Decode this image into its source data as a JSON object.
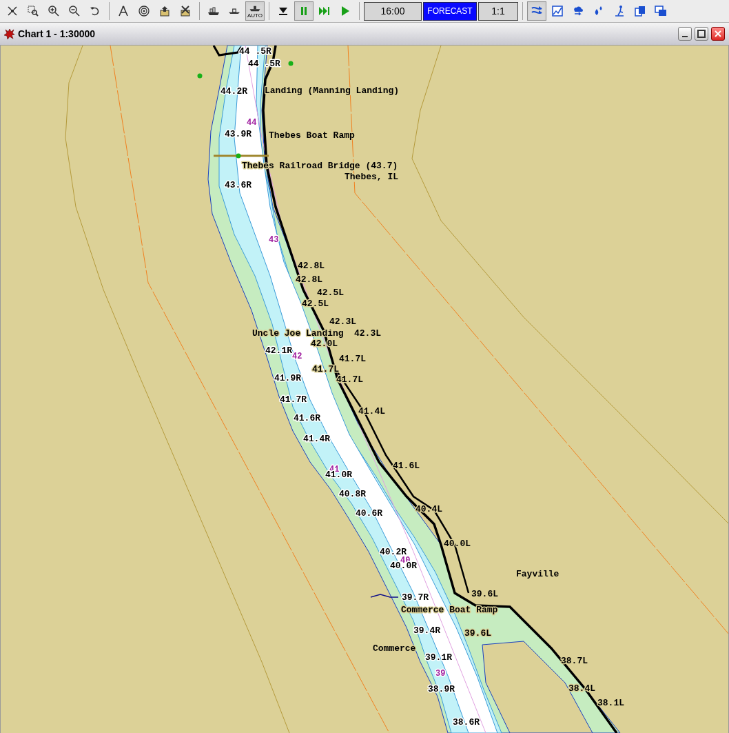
{
  "toolbar": {
    "buttons": [
      {
        "kind": "fit",
        "pressed": false
      },
      {
        "kind": "zoom-window",
        "pressed": false
      },
      {
        "kind": "zoom-in",
        "pressed": false
      },
      {
        "kind": "zoom-out",
        "pressed": false
      },
      {
        "kind": "undo",
        "pressed": false
      },
      {
        "kind": "sep"
      },
      {
        "kind": "compass",
        "pressed": false
      },
      {
        "kind": "target",
        "pressed": false
      },
      {
        "kind": "export",
        "pressed": false
      },
      {
        "kind": "delete",
        "pressed": false
      },
      {
        "kind": "sep"
      },
      {
        "kind": "ship",
        "pressed": false
      },
      {
        "kind": "boat",
        "pressed": false
      },
      {
        "kind": "auto",
        "pressed": true,
        "label": "AUTO"
      },
      {
        "kind": "sep"
      },
      {
        "kind": "stop",
        "pressed": false
      },
      {
        "kind": "pause",
        "pressed": true
      },
      {
        "kind": "fast-forward",
        "pressed": false
      },
      {
        "kind": "play",
        "pressed": false
      },
      {
        "kind": "sep"
      },
      {
        "kind": "time",
        "text": "16:00"
      },
      {
        "kind": "mode",
        "text": "FORECAST"
      },
      {
        "kind": "scale",
        "text": "1:1"
      },
      {
        "kind": "sep"
      },
      {
        "kind": "route",
        "pressed": true
      },
      {
        "kind": "graph",
        "pressed": false
      },
      {
        "kind": "weather",
        "pressed": false
      },
      {
        "kind": "drops",
        "pressed": false
      },
      {
        "kind": "person",
        "pressed": false
      },
      {
        "kind": "pages",
        "pressed": false
      },
      {
        "kind": "windows",
        "pressed": false
      }
    ]
  },
  "window": {
    "title": "Chart 1 - 1:30000"
  },
  "map": {
    "labels": [
      {
        "text": "44 .5R",
        "kind": "mile"
      },
      {
        "text": "44 .5R",
        "kind": "mile"
      },
      {
        "text": "44.2R",
        "kind": "mile"
      },
      {
        "text": "Landing (Manning Landing)",
        "kind": "place"
      },
      {
        "text": "44",
        "kind": "marker"
      },
      {
        "text": "43.9R",
        "kind": "mile"
      },
      {
        "text": "Thebes Boat Ramp",
        "kind": "place"
      },
      {
        "text": "Thebes Railroad Bridge (43.7)",
        "kind": "place"
      },
      {
        "text": "Thebes, IL",
        "kind": "place"
      },
      {
        "text": "43.6R",
        "kind": "mile"
      },
      {
        "text": "43",
        "kind": "marker"
      },
      {
        "text": "42.8L",
        "kind": "mile"
      },
      {
        "text": "42.8L",
        "kind": "mile"
      },
      {
        "text": "42.5L",
        "kind": "mile"
      },
      {
        "text": "42.5L",
        "kind": "mile"
      },
      {
        "text": "42.3L",
        "kind": "mile"
      },
      {
        "text": "Uncle Joe Landing",
        "kind": "place"
      },
      {
        "text": "42.3L",
        "kind": "mile"
      },
      {
        "text": "42.0L",
        "kind": "mile"
      },
      {
        "text": "42.1R",
        "kind": "mile"
      },
      {
        "text": "42",
        "kind": "marker"
      },
      {
        "text": "41.7L",
        "kind": "mile"
      },
      {
        "text": "41.7L",
        "kind": "mile"
      },
      {
        "text": "41.7L",
        "kind": "mile"
      },
      {
        "text": "41.9R",
        "kind": "mile"
      },
      {
        "text": "41.7R",
        "kind": "mile"
      },
      {
        "text": "41.4L",
        "kind": "mile"
      },
      {
        "text": "41.6R",
        "kind": "mile"
      },
      {
        "text": "41.4R",
        "kind": "mile"
      },
      {
        "text": "41.6L",
        "kind": "mile"
      },
      {
        "text": "41",
        "kind": "marker"
      },
      {
        "text": "41.0R",
        "kind": "mile"
      },
      {
        "text": "40.8R",
        "kind": "mile"
      },
      {
        "text": "40.6R",
        "kind": "mile"
      },
      {
        "text": "40.4L",
        "kind": "mile"
      },
      {
        "text": "40.0L",
        "kind": "mile"
      },
      {
        "text": "40.2R",
        "kind": "mile"
      },
      {
        "text": "40",
        "kind": "marker"
      },
      {
        "text": "40.0R",
        "kind": "mile"
      },
      {
        "text": "Fayville",
        "kind": "place"
      },
      {
        "text": "39.6L",
        "kind": "mile"
      },
      {
        "text": "39.7R",
        "kind": "mile"
      },
      {
        "text": "Commerce Boat Ramp",
        "kind": "place"
      },
      {
        "text": "39.4R",
        "kind": "mile"
      },
      {
        "text": "39.6L",
        "kind": "mile"
      },
      {
        "text": "Commerce",
        "kind": "place"
      },
      {
        "text": "39.1R",
        "kind": "mile"
      },
      {
        "text": "38.7L",
        "kind": "mile"
      },
      {
        "text": "39",
        "kind": "marker"
      },
      {
        "text": "38.4L",
        "kind": "mile"
      },
      {
        "text": "38.9R",
        "kind": "mile"
      },
      {
        "text": "38.1L",
        "kind": "mile"
      },
      {
        "text": "38.6R",
        "kind": "mile"
      }
    ]
  }
}
